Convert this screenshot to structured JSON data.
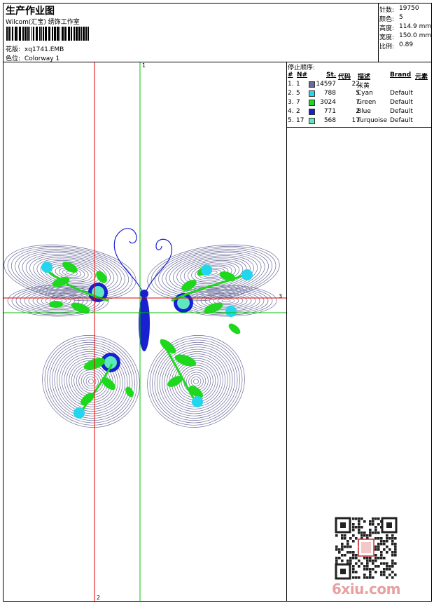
{
  "header": {
    "title": "生产作业图",
    "company": "Wilcom(汇宝) 绣饰工作室",
    "design_label": "花版:",
    "design_value": "xq1741.EMB",
    "colorway_label": "色位:",
    "colorway_value": "Colorway 1"
  },
  "stats": [
    {
      "label": "针数:",
      "value": "19750"
    },
    {
      "label": "颜色:",
      "value": "5"
    },
    {
      "label": "高度:",
      "value": "114.9 mm"
    },
    {
      "label": "宽度:",
      "value": "150.0 mm"
    },
    {
      "label": "比例:",
      "value": "0.89"
    }
  ],
  "stop_sequence": {
    "heading": "停止顺序:",
    "columns": [
      "#",
      "N#",
      "St.",
      "代码",
      "描述",
      "Brand",
      "元素"
    ],
    "rows": [
      {
        "idx": "1.",
        "n": "1",
        "color": "#6a6a9a",
        "stitches": "14597",
        "code": "22",
        "desc": "米黄",
        "brand": ""
      },
      {
        "idx": "2.",
        "n": "5",
        "color": "#22d6ee",
        "stitches": "788",
        "code": "5",
        "desc": "Cyan",
        "brand": "Default"
      },
      {
        "idx": "3.",
        "n": "7",
        "color": "#1ed81e",
        "stitches": "3024",
        "code": "7",
        "desc": "Green",
        "brand": "Default"
      },
      {
        "idx": "4.",
        "n": "2",
        "color": "#1820d0",
        "stitches": "771",
        "code": "2",
        "desc": "Blue",
        "brand": "Default"
      },
      {
        "idx": "5.",
        "n": "17",
        "color": "#5ee8c0",
        "stitches": "568",
        "code": "17",
        "desc": "Turquoise",
        "brand": "Default"
      }
    ]
  },
  "axes": {
    "top": "1",
    "bottom": "2",
    "right": "3"
  },
  "colors": {
    "thread_body": "#6a6a9a",
    "cyan": "#22d6ee",
    "green": "#1ed81e",
    "blue": "#1820d0",
    "turquoise": "#5ee8c0",
    "axis_red": "#e00000",
    "axis_green": "#00c000"
  },
  "watermark": "6xiu.com"
}
